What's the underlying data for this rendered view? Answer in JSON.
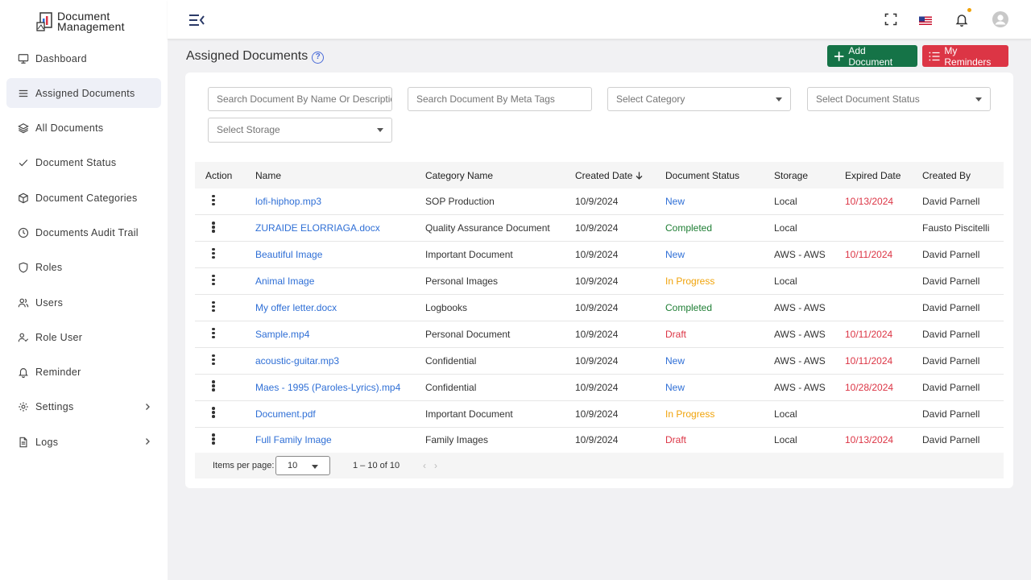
{
  "brand": {
    "line1": "Document",
    "line2": "Management"
  },
  "nav": [
    {
      "label": "Dashboard",
      "icon": "monitor-icon",
      "active": false
    },
    {
      "label": "Assigned Documents",
      "icon": "list-icon",
      "active": true
    },
    {
      "label": "All Documents",
      "icon": "layers-icon",
      "active": false
    },
    {
      "label": "Document Status",
      "icon": "check-icon",
      "active": false
    },
    {
      "label": "Document Categories",
      "icon": "box-icon",
      "active": false
    },
    {
      "label": "Documents Audit Trail",
      "icon": "clock-icon",
      "active": false
    },
    {
      "label": "Roles",
      "icon": "shield-icon",
      "active": false
    },
    {
      "label": "Users",
      "icon": "users-icon",
      "active": false
    },
    {
      "label": "Role User",
      "icon": "user-check-icon",
      "active": false
    },
    {
      "label": "Reminder",
      "icon": "bell-icon",
      "active": false
    },
    {
      "label": "Settings",
      "icon": "gear-icon",
      "active": false,
      "expandable": true
    },
    {
      "label": "Logs",
      "icon": "file-icon",
      "active": false,
      "expandable": true
    }
  ],
  "page": {
    "title": "Assigned Documents"
  },
  "actions": {
    "add": "Add Document",
    "reminders": "My Reminders"
  },
  "filters": {
    "search_name": "Search Document By Name Or Description",
    "search_tags": "Search Document By Meta Tags",
    "category": "Select Category",
    "status": "Select Document Status",
    "storage": "Select Storage"
  },
  "table": {
    "headers": [
      "Action",
      "Name",
      "Category Name",
      "Created Date",
      "Document Status",
      "Storage",
      "Expired Date",
      "Created By"
    ],
    "rows": [
      {
        "name": "lofi-hiphop.mp3",
        "category": "SOP Production",
        "created": "10/9/2024",
        "status": "New",
        "status_class": "st-new",
        "storage": "Local",
        "expired": "10/13/2024",
        "by": "David Parnell"
      },
      {
        "name": "ZURAIDE ELORRIAGA.docx",
        "category": "Quality Assurance Document",
        "created": "10/9/2024",
        "status": "Completed",
        "status_class": "st-completed",
        "storage": "Local",
        "expired": "",
        "by": "Fausto Piscitelli"
      },
      {
        "name": "Beautiful Image",
        "category": "Important Document",
        "created": "10/9/2024",
        "status": "New",
        "status_class": "st-new",
        "storage": "AWS - AWS",
        "expired": "10/11/2024",
        "by": "David Parnell"
      },
      {
        "name": "Animal Image",
        "category": "Personal Images",
        "created": "10/9/2024",
        "status": "In Progress",
        "status_class": "st-progress",
        "storage": "Local",
        "expired": "",
        "by": "David Parnell"
      },
      {
        "name": "My offer letter.docx",
        "category": "Logbooks",
        "created": "10/9/2024",
        "status": "Completed",
        "status_class": "st-completed",
        "storage": "AWS - AWS",
        "expired": "",
        "by": "David Parnell"
      },
      {
        "name": "Sample.mp4",
        "category": "Personal Document",
        "created": "10/9/2024",
        "status": "Draft",
        "status_class": "st-draft",
        "storage": "AWS - AWS",
        "expired": "10/11/2024",
        "by": "David Parnell"
      },
      {
        "name": "acoustic-guitar.mp3",
        "category": "Confidential",
        "created": "10/9/2024",
        "status": "New",
        "status_class": "st-new",
        "storage": "AWS - AWS",
        "expired": "10/11/2024",
        "by": "David Parnell"
      },
      {
        "name": "Maes - 1995 (Paroles-Lyrics).mp4",
        "category": "Confidential",
        "created": "10/9/2024",
        "status": "New",
        "status_class": "st-new",
        "storage": "AWS - AWS",
        "expired": "10/28/2024",
        "by": "David Parnell"
      },
      {
        "name": "Document.pdf",
        "category": "Important Document",
        "created": "10/9/2024",
        "status": "In Progress",
        "status_class": "st-progress",
        "storage": "Local",
        "expired": "",
        "by": "David Parnell"
      },
      {
        "name": "Full Family Image",
        "category": "Family Images",
        "created": "10/9/2024",
        "status": "Draft",
        "status_class": "st-draft",
        "storage": "Local",
        "expired": "10/13/2024",
        "by": "David Parnell"
      }
    ]
  },
  "pager": {
    "label": "Items per page:",
    "size": "10",
    "range": "1 – 10 of 10"
  },
  "colors": {
    "add": "#157347",
    "reminders": "#dc3545",
    "link": "#2f6fd6",
    "notification_dot": "#f0a30a"
  }
}
